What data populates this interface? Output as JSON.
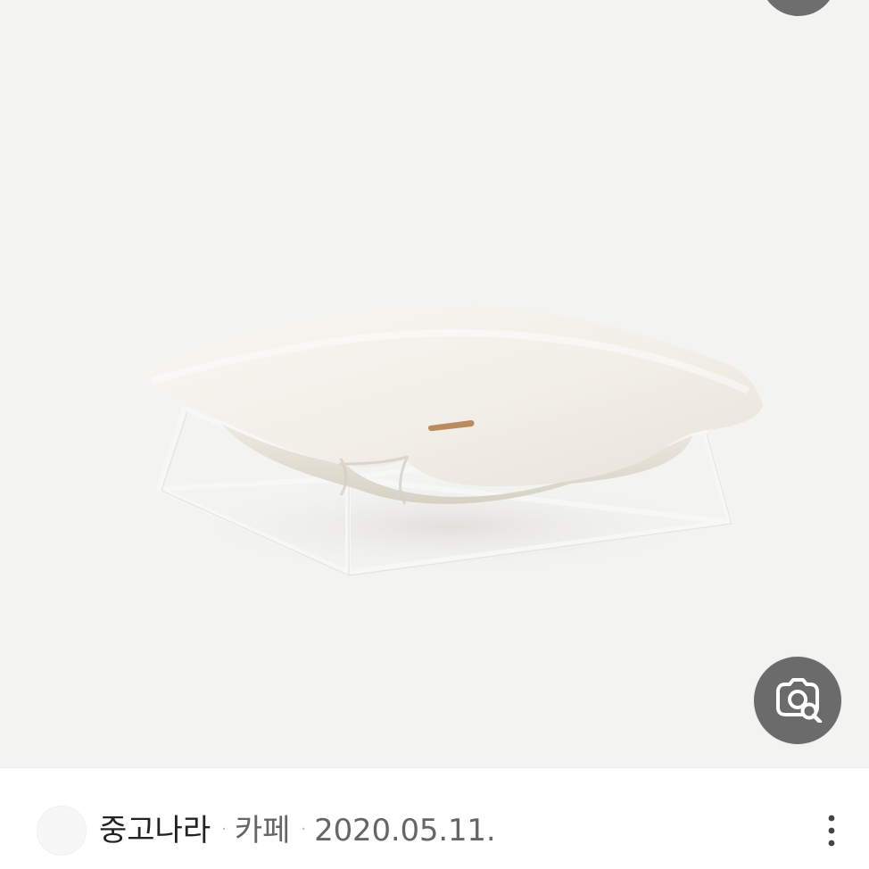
{
  "image_viewer": {
    "product_image_alt": "",
    "top_button_icon": "circle-button-icon",
    "lens_button_icon": "visual-search-icon"
  },
  "result_meta": {
    "source": "중고나라",
    "separator": "·",
    "type": "카페",
    "date": "2020.05.11.",
    "more_icon": "more-vertical-icon"
  },
  "colors": {
    "photo_background": "#f3f3f1",
    "button_gray": "#6b6b6b",
    "text_dark": "#222222",
    "text_gray": "#666666",
    "separator": "#b8b8b8"
  }
}
